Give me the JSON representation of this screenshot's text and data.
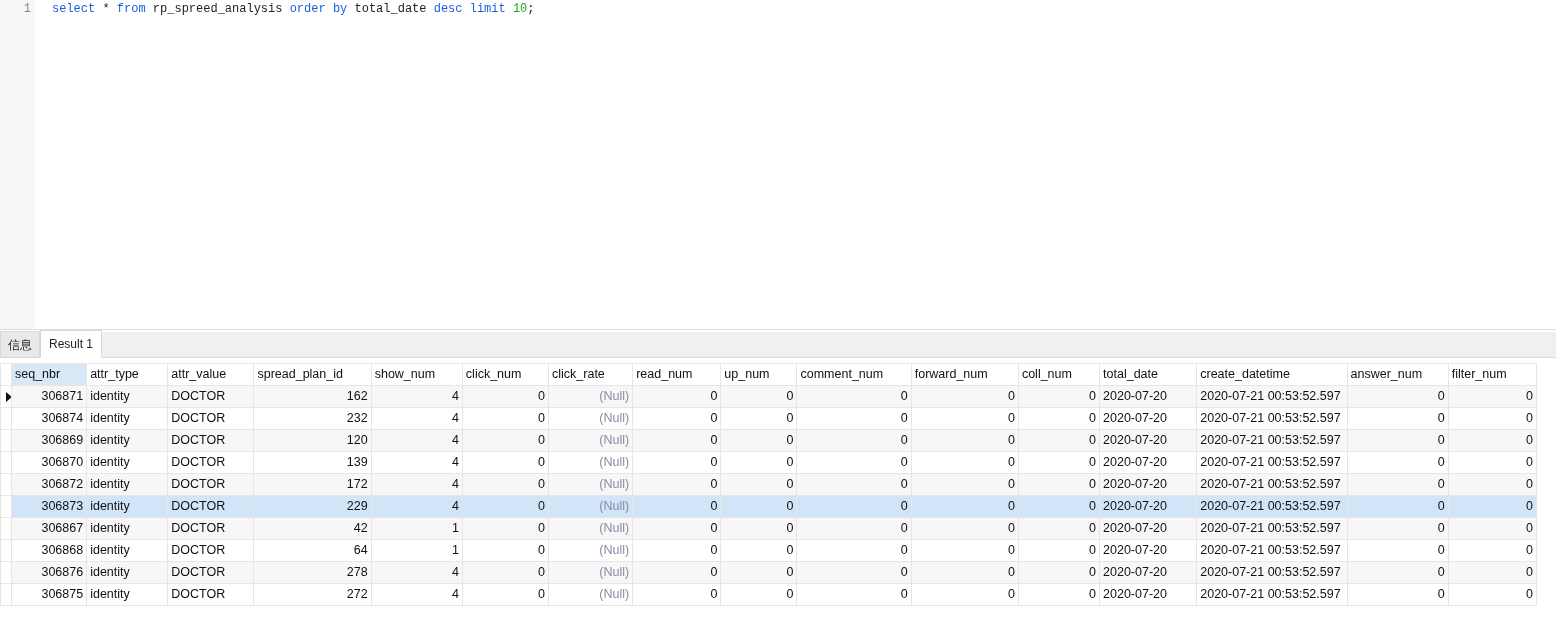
{
  "editor": {
    "lines": [
      {
        "number": "1",
        "tokens": [
          {
            "kind": "keyword",
            "text": "select"
          },
          {
            "kind": "plain",
            "text": " * "
          },
          {
            "kind": "keyword",
            "text": "from"
          },
          {
            "kind": "plain",
            "text": " rp_spreed_analysis "
          },
          {
            "kind": "keyword",
            "text": "order by"
          },
          {
            "kind": "plain",
            "text": " total_date "
          },
          {
            "kind": "keyword",
            "text": "desc limit"
          },
          {
            "kind": "number",
            "text": " 10"
          },
          {
            "kind": "plain",
            "text": ";"
          }
        ]
      }
    ]
  },
  "tabs": [
    {
      "label": "信息",
      "selected": false
    },
    {
      "label": "Result 1",
      "selected": true
    }
  ],
  "grid": {
    "columns": [
      {
        "name": "seq_nbr",
        "kind": "numeric",
        "selected": true
      },
      {
        "name": "attr_type",
        "kind": "text",
        "selected": false
      },
      {
        "name": "attr_value",
        "kind": "text",
        "selected": false
      },
      {
        "name": "spread_plan_id",
        "kind": "numeric",
        "selected": false
      },
      {
        "name": "show_num",
        "kind": "numeric",
        "selected": false
      },
      {
        "name": "click_num",
        "kind": "numeric",
        "selected": false
      },
      {
        "name": "click_rate",
        "kind": "numeric",
        "selected": false
      },
      {
        "name": "read_num",
        "kind": "numeric",
        "selected": false
      },
      {
        "name": "up_num",
        "kind": "numeric",
        "selected": false
      },
      {
        "name": "comment_num",
        "kind": "numeric",
        "selected": false
      },
      {
        "name": "forward_num",
        "kind": "numeric",
        "selected": false
      },
      {
        "name": "coll_num",
        "kind": "numeric",
        "selected": false
      },
      {
        "name": "total_date",
        "kind": "text",
        "selected": false
      },
      {
        "name": "create_datetime",
        "kind": "text",
        "selected": false
      },
      {
        "name": "answer_num",
        "kind": "numeric",
        "selected": false
      },
      {
        "name": "filter_num",
        "kind": "numeric",
        "selected": false
      }
    ],
    "rows": [
      {
        "current": true,
        "hovered": false,
        "cells": [
          "306871",
          "identity",
          "DOCTOR",
          "162",
          "4",
          "0",
          {
            "text": "(Null)",
            "is_null": true
          },
          "0",
          "0",
          "0",
          "0",
          "0",
          "2020-07-20",
          "2020-07-21 00:53:52.597",
          "0",
          "0"
        ]
      },
      {
        "current": false,
        "hovered": false,
        "cells": [
          "306874",
          "identity",
          "DOCTOR",
          "232",
          "4",
          "0",
          {
            "text": "(Null)",
            "is_null": true
          },
          "0",
          "0",
          "0",
          "0",
          "0",
          "2020-07-20",
          "2020-07-21 00:53:52.597",
          "0",
          "0"
        ]
      },
      {
        "current": false,
        "hovered": false,
        "cells": [
          "306869",
          "identity",
          "DOCTOR",
          "120",
          "4",
          "0",
          {
            "text": "(Null)",
            "is_null": true
          },
          "0",
          "0",
          "0",
          "0",
          "0",
          "2020-07-20",
          "2020-07-21 00:53:52.597",
          "0",
          "0"
        ]
      },
      {
        "current": false,
        "hovered": false,
        "cells": [
          "306870",
          "identity",
          "DOCTOR",
          "139",
          "4",
          "0",
          {
            "text": "(Null)",
            "is_null": true
          },
          "0",
          "0",
          "0",
          "0",
          "0",
          "2020-07-20",
          "2020-07-21 00:53:52.597",
          "0",
          "0"
        ]
      },
      {
        "current": false,
        "hovered": false,
        "cells": [
          "306872",
          "identity",
          "DOCTOR",
          "172",
          "4",
          "0",
          {
            "text": "(Null)",
            "is_null": true
          },
          "0",
          "0",
          "0",
          "0",
          "0",
          "2020-07-20",
          "2020-07-21 00:53:52.597",
          "0",
          "0"
        ]
      },
      {
        "current": false,
        "hovered": true,
        "cells": [
          "306873",
          "identity",
          "DOCTOR",
          "229",
          "4",
          "0",
          {
            "text": "(Null)",
            "is_null": true
          },
          "0",
          "0",
          "0",
          "0",
          "0",
          "2020-07-20",
          "2020-07-21 00:53:52.597",
          "0",
          "0"
        ]
      },
      {
        "current": false,
        "hovered": false,
        "cells": [
          "306867",
          "identity",
          "DOCTOR",
          "42",
          "1",
          "0",
          {
            "text": "(Null)",
            "is_null": true
          },
          "0",
          "0",
          "0",
          "0",
          "0",
          "2020-07-20",
          "2020-07-21 00:53:52.597",
          "0",
          "0"
        ]
      },
      {
        "current": false,
        "hovered": false,
        "cells": [
          "306868",
          "identity",
          "DOCTOR",
          "64",
          "1",
          "0",
          {
            "text": "(Null)",
            "is_null": true
          },
          "0",
          "0",
          "0",
          "0",
          "0",
          "2020-07-20",
          "2020-07-21 00:53:52.597",
          "0",
          "0"
        ]
      },
      {
        "current": false,
        "hovered": false,
        "cells": [
          "306876",
          "identity",
          "DOCTOR",
          "278",
          "4",
          "0",
          {
            "text": "(Null)",
            "is_null": true
          },
          "0",
          "0",
          "0",
          "0",
          "0",
          "2020-07-20",
          "2020-07-21 00:53:52.597",
          "0",
          "0"
        ]
      },
      {
        "current": false,
        "hovered": false,
        "cells": [
          "306875",
          "identity",
          "DOCTOR",
          "272",
          "4",
          "0",
          {
            "text": "(Null)",
            "is_null": true
          },
          "0",
          "0",
          "0",
          "0",
          "0",
          "2020-07-20",
          "2020-07-21 00:53:52.597",
          "0",
          "0"
        ]
      }
    ]
  }
}
